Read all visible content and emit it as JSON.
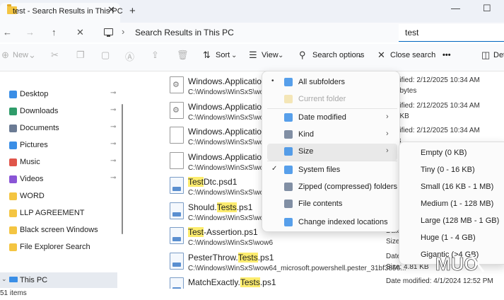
{
  "window": {
    "tab_title": "test - Search Results in This PC",
    "tab_close": "✕",
    "new_tab": "+",
    "minimize": "—",
    "maximize": "☐"
  },
  "nav": {
    "back": "←",
    "forward": "→",
    "up": "↑",
    "stop": "✕",
    "chevron": "›",
    "address": "Search Results in This PC",
    "search_value": "test"
  },
  "toolbar": {
    "new_label": "New",
    "sort_label": "Sort",
    "view_label": "View",
    "search_options_label": "Search options",
    "close_search_label": "Close search",
    "more_label": "•••",
    "details_label": "Det"
  },
  "sidebar": {
    "items": [
      {
        "label": "Desktop",
        "icon": "desktop-icon",
        "color": "#3a8ee6",
        "pinned": true
      },
      {
        "label": "Downloads",
        "icon": "downloads-icon",
        "color": "#2f9c6a",
        "pinned": true
      },
      {
        "label": "Documents",
        "icon": "documents-icon",
        "color": "#6b7b94",
        "pinned": true
      },
      {
        "label": "Pictures",
        "icon": "pictures-icon",
        "color": "#3a8ee6",
        "pinned": true
      },
      {
        "label": "Music",
        "icon": "music-icon",
        "color": "#e0554a",
        "pinned": true
      },
      {
        "label": "Videos",
        "icon": "videos-icon",
        "color": "#8a55d6",
        "pinned": true
      },
      {
        "label": "WORD",
        "icon": "folder-icon",
        "color": "#f4c542",
        "pinned": false
      },
      {
        "label": "LLP AGREEMENT",
        "icon": "folder-icon",
        "color": "#f4c542",
        "pinned": false
      },
      {
        "label": "Black screen Windows",
        "icon": "folder-icon",
        "color": "#f4c542",
        "pinned": false
      },
      {
        "label": "File Explorer Search",
        "icon": "folder-icon",
        "color": "#f4c542",
        "pinned": false
      }
    ],
    "this_pc": "This PC",
    "pin_glyph": "📌"
  },
  "status": {
    "items_text": "51 items"
  },
  "files": [
    {
      "name_pre": "Windows.ApplicationM",
      "name_hl": "",
      "name_post": "",
      "path": "C:\\Windows\\WinSxS\\wow6",
      "meta1": "modified: 2/12/2025 10:34 AM",
      "meta2": "624 bytes",
      "icon": "cfg"
    },
    {
      "name_pre": "Windows.ApplicationM",
      "name_hl": "",
      "name_post": "",
      "path": "C:\\Windows\\WinSxS\\wow6",
      "meta1": "modified: 2/12/2025 10:34 AM",
      "meta2": "239 KB",
      "icon": "cfg"
    },
    {
      "name_pre": "Windows.ApplicationM",
      "name_hl": "",
      "name_post": "",
      "path": "C:\\Windows\\WinSxS\\wow6",
      "meta1": "modified: 2/12/2025 10:34 AM",
      "meta2": "1 KB",
      "icon": "blank"
    },
    {
      "name_pre": "Windows.ApplicationM",
      "name_hl": "",
      "name_post": "",
      "path": "C:\\Windows\\WinSxS\\wow6",
      "meta1": "modified: 2/12/2025 10:34 AM",
      "meta2": "1 KB",
      "icon": "blank"
    },
    {
      "name_pre": "",
      "name_hl": "Test",
      "name_post": "Dtc.psd1",
      "path": "C:\\Windows\\WinSxS\\wow6",
      "meta1": "",
      "meta2": "",
      "icon": "ps"
    },
    {
      "name_pre": "Should.",
      "name_hl": "Tests",
      "name_post": ".ps1",
      "path": "C:\\Windows\\WinSxS\\wow6",
      "meta1": "",
      "meta2": "",
      "icon": "ps"
    },
    {
      "name_pre": "",
      "name_hl": "Test",
      "name_post": "-Assertion.ps1",
      "path": "C:\\Windows\\WinSxS\\wow6",
      "meta1": "Date",
      "meta2": "Size:",
      "icon": "ps"
    },
    {
      "name_pre": "PesterThrow.",
      "name_hl": "Tests",
      "name_post": ".ps1",
      "path": "C:\\Windows\\WinSxS\\wow64_microsoft.powershell.pester_31bf3856...",
      "meta1": "Date modified: 4/1/2024 12:52 PM",
      "meta2": "Size: 4.81 KB",
      "icon": "ps"
    },
    {
      "name_pre": "MatchExactly.",
      "name_hl": "Tests",
      "name_post": ".ps1",
      "path": "",
      "meta1": "Date modified: 4/1/2024 12:52 PM",
      "meta2": "",
      "icon": "ps"
    }
  ],
  "search_menu": {
    "items": [
      {
        "label": "All subfolders",
        "check": "•",
        "arrow": "",
        "disabled": false,
        "icon_color": "#3a8ee6"
      },
      {
        "label": "Current folder",
        "check": "",
        "arrow": "",
        "disabled": true,
        "icon_color": "#f0d98a"
      },
      {
        "label": "Date modified",
        "check": "",
        "arrow": "›",
        "disabled": false,
        "icon_color": "#3a8ee6"
      },
      {
        "label": "Kind",
        "check": "",
        "arrow": "›",
        "disabled": false,
        "icon_color": "#6b7b94"
      },
      {
        "label": "Size",
        "check": "",
        "arrow": "›",
        "disabled": false,
        "icon_color": "#3a8ee6"
      },
      {
        "label": "System files",
        "check": "✓",
        "arrow": "",
        "disabled": false,
        "icon_color": "#3a8ee6"
      },
      {
        "label": "Zipped (compressed) folders",
        "check": "",
        "arrow": "",
        "disabled": false,
        "icon_color": "#6b7b94"
      },
      {
        "label": "File contents",
        "check": "",
        "arrow": "",
        "disabled": false,
        "icon_color": "#6b7b94"
      },
      {
        "label": "Change indexed locations",
        "check": "",
        "arrow": "",
        "disabled": false,
        "icon_color": "#3a8ee6"
      }
    ]
  },
  "size_submenu": {
    "items": [
      "Empty (0 KB)",
      "Tiny (0 - 16 KB)",
      "Small (16 KB - 1 MB)",
      "Medium (1 - 128 MB)",
      "Large (128 MB - 1 GB)",
      "Huge (1 - 4 GB)",
      "Gigantic (>4 GB)"
    ]
  },
  "watermark": {
    "text": "MUO"
  },
  "colors": {
    "accent": "#0067c0",
    "highlight": "#fcec6e",
    "folder": "#f4c542"
  }
}
